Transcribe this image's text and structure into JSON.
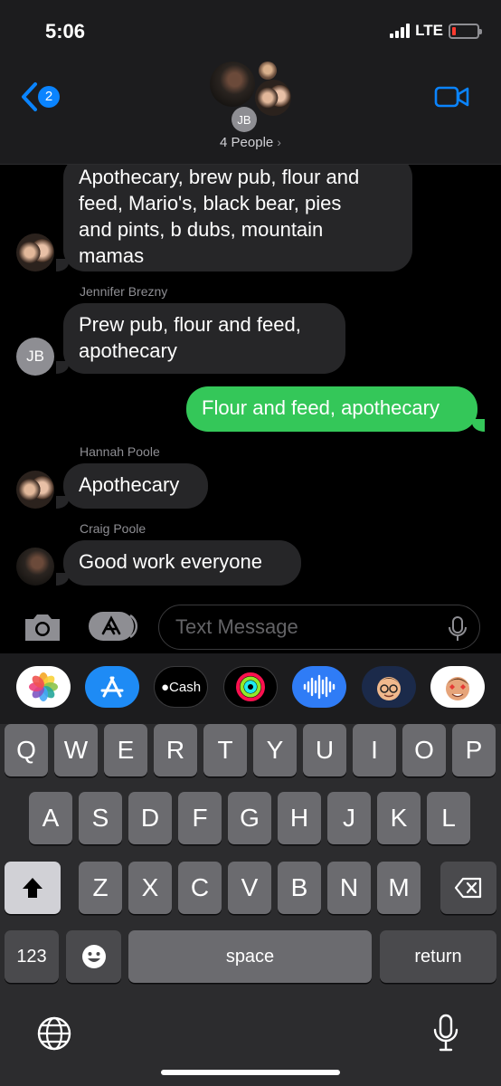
{
  "status_bar": {
    "time": "5:06",
    "network": "LTE",
    "battery_level": 0.15
  },
  "header": {
    "back_badge": "2",
    "group_initials": "JB",
    "group_title": "4 People",
    "title_chevron": "›"
  },
  "messages": [
    {
      "direction": "in",
      "sender": "",
      "lines": [
        "Apothecary, brew pub, flour and",
        "feed, Mario's, black bear, pies",
        "and pints, b dubs, mountain",
        "mamas"
      ]
    },
    {
      "direction": "in",
      "sender": "Jennifer Brezny",
      "avatar_initials": "JB",
      "lines": [
        "Prew pub, flour and feed,",
        "apothecary"
      ]
    },
    {
      "direction": "out",
      "lines": [
        "Flour and feed, apothecary"
      ]
    },
    {
      "direction": "in",
      "sender": "Hannah Poole",
      "lines": [
        "Apothecary"
      ]
    },
    {
      "direction": "in",
      "sender": "Craig Poole",
      "lines": [
        "Good work everyone"
      ]
    }
  ],
  "input": {
    "placeholder": "Text Message"
  },
  "tray": {
    "apps": [
      "photos-icon",
      "app-store-icon",
      "apple-cash-icon",
      "activity-icon",
      "audio-message-icon",
      "memoji-icon",
      "memoji-stickers-icon"
    ],
    "cash_label": "Cash"
  },
  "keyboard": {
    "row1": [
      "Q",
      "W",
      "E",
      "R",
      "T",
      "Y",
      "U",
      "I",
      "O",
      "P"
    ],
    "row2": [
      "A",
      "S",
      "D",
      "F",
      "G",
      "H",
      "J",
      "K",
      "L"
    ],
    "row3": [
      "Z",
      "X",
      "C",
      "V",
      "B",
      "N",
      "M"
    ],
    "numbers_label": "123",
    "space_label": "space",
    "return_label": "return"
  },
  "colors": {
    "accent": "#0a84ff",
    "outgoing": "#34c759",
    "incoming": "#262628"
  }
}
